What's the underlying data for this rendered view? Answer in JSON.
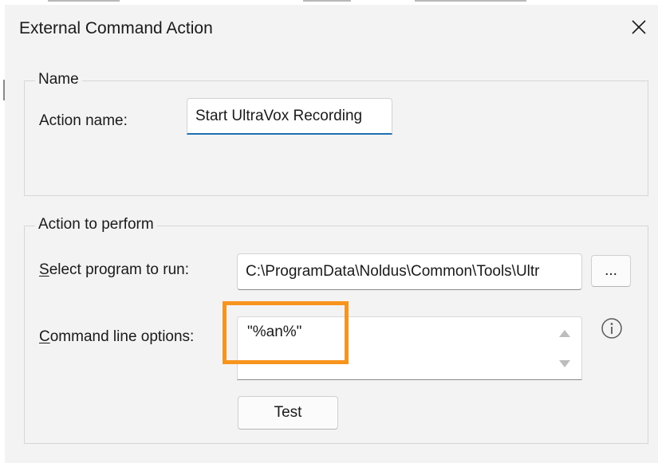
{
  "window": {
    "title": "External Command Action",
    "close_icon": "close-icon"
  },
  "name_group": {
    "title": "Name",
    "action_name_label": "Action name:",
    "action_name_value": "Start UltraVox Recording"
  },
  "action_group": {
    "title": "Action to perform",
    "program_label_mnemonic": "S",
    "program_label_rest": "elect program to run:",
    "program_value": "C:\\ProgramData\\Noldus\\Common\\Tools\\Ultr",
    "browse_label": "...",
    "command_label_mnemonic": "C",
    "command_label_rest": "ommand line options:",
    "command_value": "\"%an%\"",
    "info_icon": "info-icon",
    "test_label": "Test"
  },
  "colors": {
    "accent": "#1f6fb3",
    "highlight": "#f7941d",
    "background": "#f3f3f3"
  }
}
